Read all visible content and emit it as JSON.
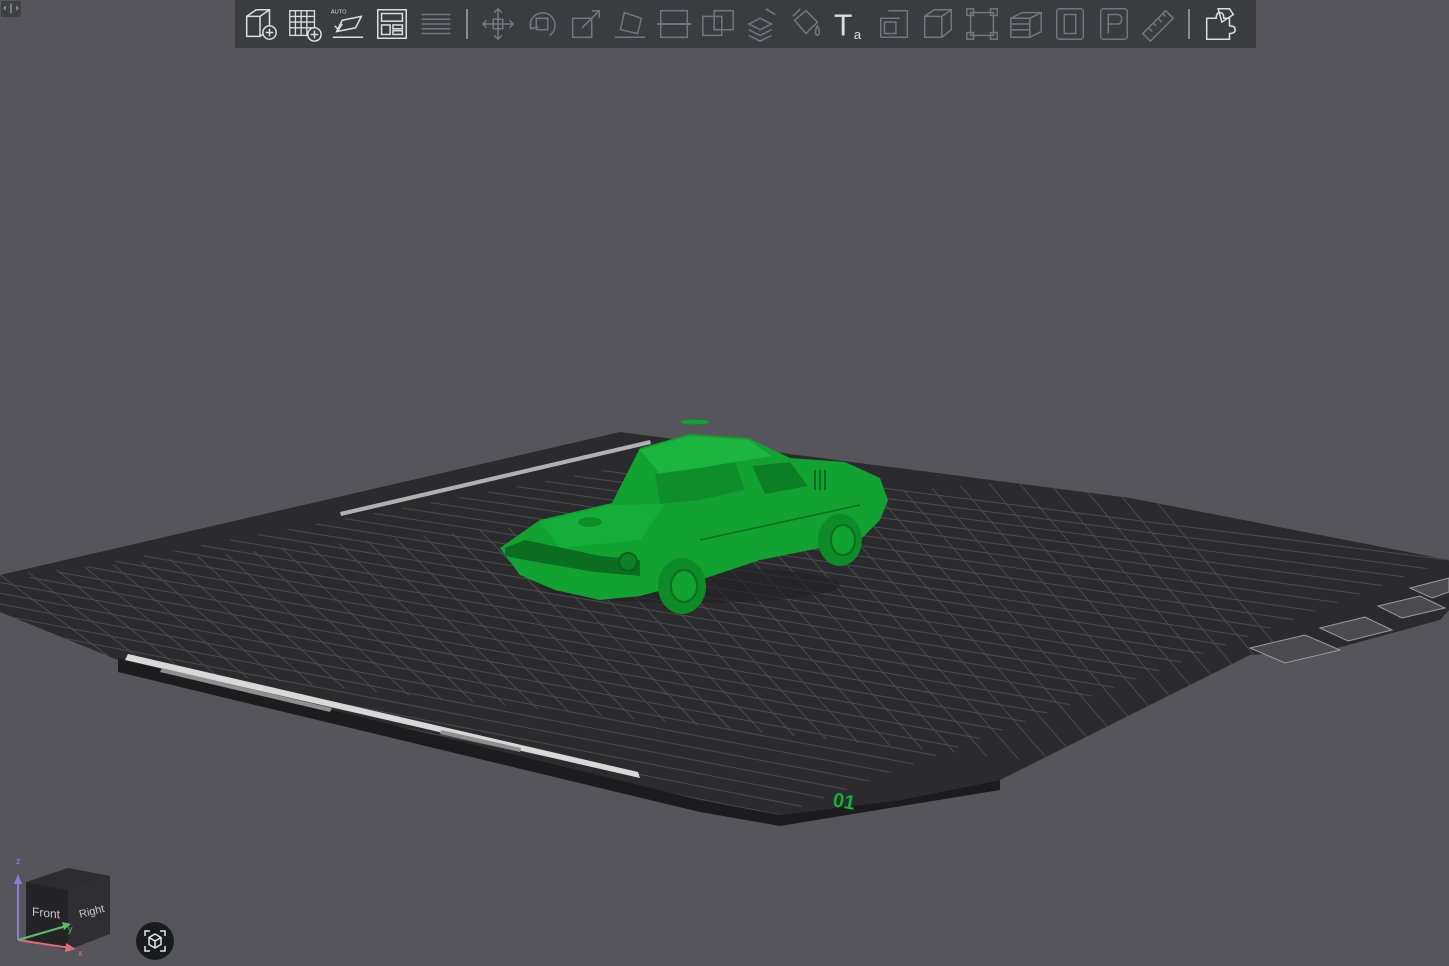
{
  "window": {
    "corner_toggle_label": "‹|›"
  },
  "toolbar": {
    "buttons": [
      {
        "id": "add-object",
        "icon": "add-cube-icon",
        "enabled": true
      },
      {
        "id": "add-plate",
        "icon": "add-grid-plate-icon",
        "enabled": true
      },
      {
        "id": "auto-orient",
        "icon": "auto-orient-icon",
        "badge": "AUTO",
        "enabled": true
      },
      {
        "id": "arrange",
        "icon": "arrange-layout-icon",
        "enabled": true
      },
      {
        "id": "layers",
        "icon": "layers-icon",
        "enabled": false
      },
      {
        "id": "move",
        "icon": "move-arrows-icon",
        "enabled": false
      },
      {
        "id": "rotate",
        "icon": "rotate-icon",
        "enabled": false
      },
      {
        "id": "scale",
        "icon": "scale-icon",
        "enabled": false
      },
      {
        "id": "lay-on-face",
        "icon": "lay-on-face-icon",
        "enabled": false
      },
      {
        "id": "cut",
        "icon": "cut-icon",
        "enabled": false
      },
      {
        "id": "boolean",
        "icon": "boolean-icon",
        "enabled": false
      },
      {
        "id": "support-paint",
        "icon": "support-paint-icon",
        "enabled": false
      },
      {
        "id": "color-paint",
        "icon": "color-bucket-icon",
        "enabled": false
      },
      {
        "id": "text",
        "icon": "text-icon",
        "label": "T",
        "sub_label": "a",
        "enabled": true
      },
      {
        "id": "measure-corner",
        "icon": "corner-icon",
        "enabled": false
      },
      {
        "id": "assembly",
        "icon": "assembly-cube-icon",
        "enabled": false
      },
      {
        "id": "bounding",
        "icon": "bounding-box-icon",
        "enabled": false
      },
      {
        "id": "stack",
        "icon": "stack-icon",
        "enabled": false
      },
      {
        "id": "variable-height",
        "icon": "variable-height-icon",
        "enabled": false
      },
      {
        "id": "seam",
        "icon": "seam-icon",
        "enabled": false
      },
      {
        "id": "measure",
        "icon": "ruler-icon",
        "enabled": false
      },
      {
        "id": "assembly-view",
        "icon": "puzzle-icon",
        "enabled": true
      }
    ]
  },
  "scene": {
    "plate_label": "01",
    "model_color": "#12a232",
    "plate_color": "#2b2b2e",
    "grid_color": "#4a4a4f",
    "background_color": "#55555b"
  },
  "nav_cube": {
    "front_label": "Front",
    "right_label": "Right",
    "axis_z": "z",
    "axis_y": "y",
    "axis_x": "x"
  }
}
